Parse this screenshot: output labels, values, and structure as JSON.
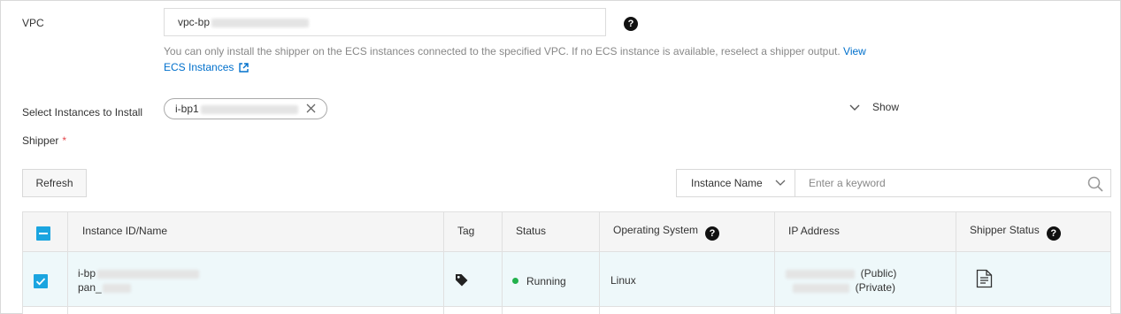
{
  "form": {
    "vpc_label": "VPC",
    "vpc_value": "vpc-bp",
    "vpc_help": "?",
    "hint_text": "You can only install the shipper on the ECS instances connected to the specified VPC. If no ECS instance is available, reselect a shipper output.",
    "hint_link": "View ECS Instances",
    "select_label_line1": "Select Instances to Install",
    "select_label_line2": "Shipper",
    "required_mark": "*",
    "selected_instance": "i-bp1",
    "show_label": "Show"
  },
  "toolbar": {
    "refresh_label": "Refresh",
    "search_field_option": "Instance Name",
    "search_placeholder": "Enter a keyword"
  },
  "table": {
    "columns": {
      "instance": "Instance ID/Name",
      "tag": "Tag",
      "status": "Status",
      "os": "Operating System",
      "ip": "IP Address",
      "shipper_status": "Shipper Status"
    },
    "help_glyph": "?",
    "rows": [
      {
        "instance_id": "i-bp",
        "instance_name": "pan_",
        "status": "Running",
        "os": "Linux",
        "ip_public_label": "(Public)",
        "ip_private_label": "(Private)"
      }
    ]
  },
  "colors": {
    "accent": "#1ba5e0",
    "link": "#0070cc",
    "running": "#22b14c",
    "row_selected": "#eef8fa"
  }
}
